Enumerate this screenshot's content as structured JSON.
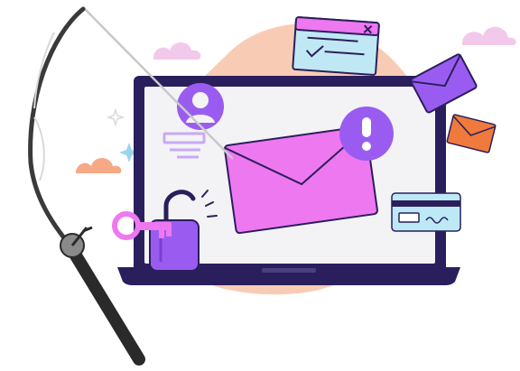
{
  "scene": {
    "colors": {
      "blob": "#f8ccb4",
      "cloud": "#f2c9ea",
      "cloud_orange": "#f6a987",
      "laptop_frame": "#2a1f5c",
      "laptop_screen": "#f3f3f6",
      "laptop_base": "#2a1f5c",
      "envelope_main": "#ee78f0",
      "envelope_flap": "#d65fd8",
      "envelope_purple": "#9a5cf0",
      "envelope_orange": "#f07a3c",
      "alert_badge": "#9a5cf0",
      "lock": "#9a5cf0",
      "key": "#ee78f0",
      "card": "#bde8f5",
      "window_card": "#bfe8f4",
      "window_bar": "#ee78f0",
      "rod": "#3a3a3a",
      "rod_handle": "#2a2a2a",
      "reel": "#8a8a8a",
      "line": "#c9c9c9"
    },
    "icons": [
      "fishing-rod-icon",
      "envelope-icon",
      "alert-icon",
      "user-avatar-icon",
      "padlock-open-icon",
      "key-icon",
      "credit-card-icon",
      "browser-window-icon",
      "laptop-icon",
      "cloud-icon",
      "sparkle-icon"
    ]
  }
}
